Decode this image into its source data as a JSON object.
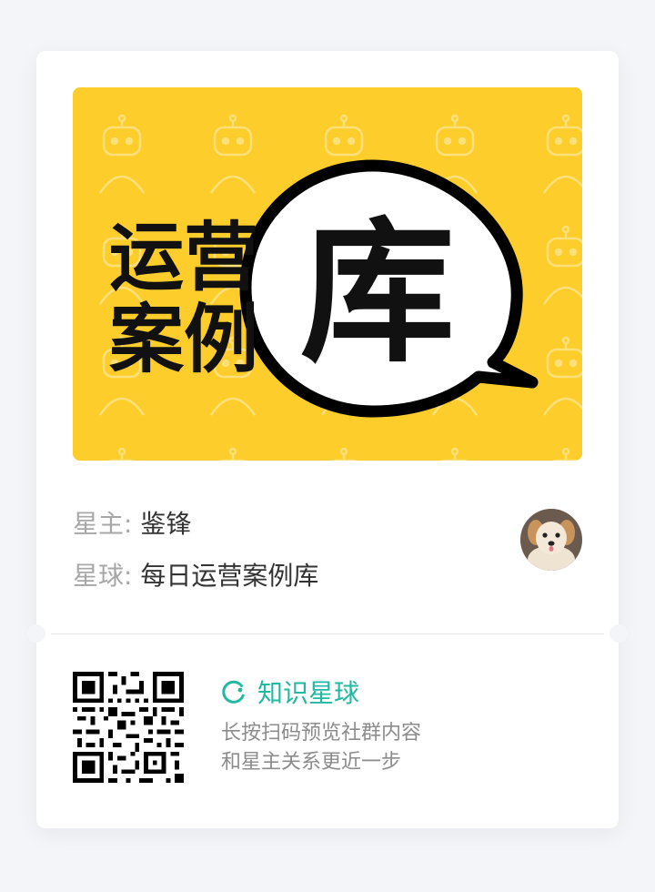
{
  "banner": {
    "title_line1": "运营",
    "title_line2": "案例",
    "bubble_char": "库",
    "bg_color": "#fccd2b",
    "pattern_icon": "robot-face-icon"
  },
  "owner": {
    "label": "星主:",
    "name": "鉴锋"
  },
  "planet": {
    "label": "星球:",
    "name": "每日运营案例库"
  },
  "avatar": {
    "alt": "puppy avatar"
  },
  "footer": {
    "brand_name": "知识星球",
    "brand_color": "#23b8a0",
    "brand_icon": "planet-logo-icon",
    "desc_line1": "长按扫码预览社群内容",
    "desc_line2": "和星主关系更近一步"
  }
}
